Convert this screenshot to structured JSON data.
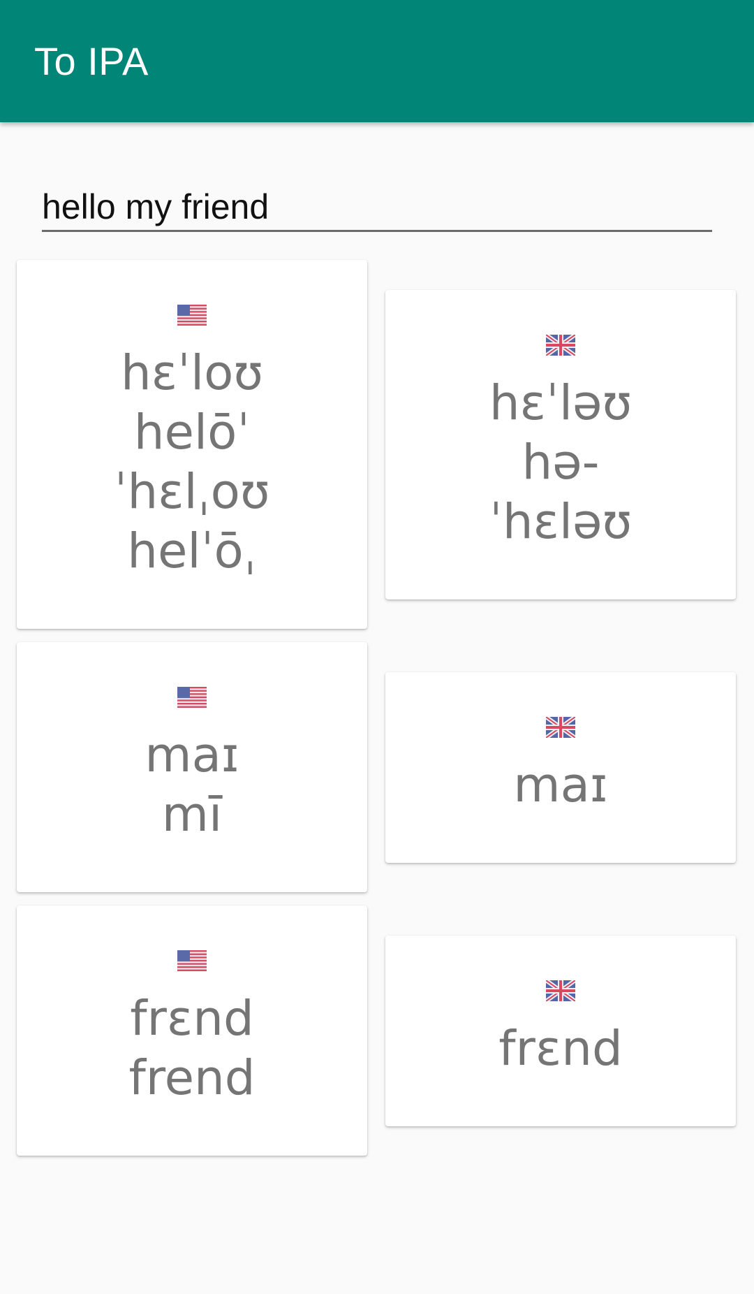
{
  "app_bar": {
    "title": "To IPA"
  },
  "search": {
    "value": "hello my friend"
  },
  "colors": {
    "primary": "#008577",
    "ipa_text": "#757575"
  },
  "cards": [
    {
      "flag": "us-flag-icon",
      "lines": [
        "hɛˈloʊ",
        "helōˈ",
        "ˈhɛlˌoʊ",
        "helˈōˌ"
      ]
    },
    {
      "flag": "uk-flag-icon",
      "lines": [
        "hɛˈləʊ",
        "hə-",
        "ˈhɛləʊ"
      ]
    },
    {
      "flag": "us-flag-icon",
      "lines": [
        "maɪ",
        "mī"
      ]
    },
    {
      "flag": "uk-flag-icon",
      "lines": [
        "maɪ"
      ]
    },
    {
      "flag": "us-flag-icon",
      "lines": [
        "frɛnd",
        "frend"
      ]
    },
    {
      "flag": "uk-flag-icon",
      "lines": [
        "frɛnd"
      ]
    }
  ]
}
